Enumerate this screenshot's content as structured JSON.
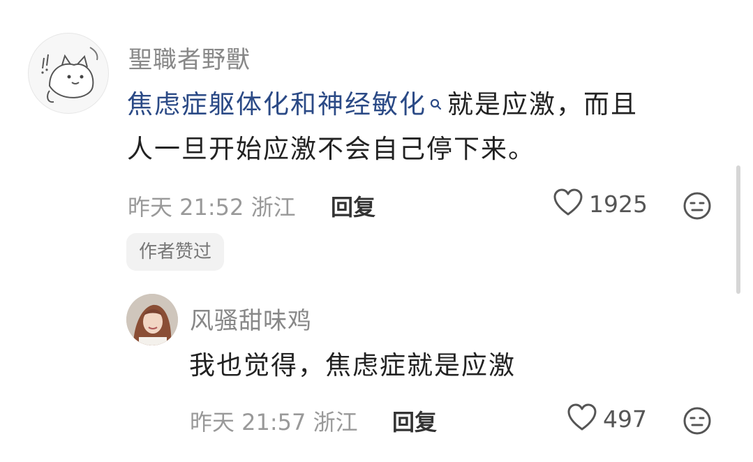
{
  "comment": {
    "username": "聖職者野獸",
    "link_text": "焦虑症躯体化和神经敏化",
    "text_line1": "就是应激，而且",
    "text_line2": "人一旦开始应激不会自己停下来。",
    "time": "昨天 21:52 浙江",
    "reply_label": "回复",
    "likes": "1925",
    "badge": "作者赞过"
  },
  "reply": {
    "username": "风骚甜味鸡",
    "text": "我也觉得，焦虑症就是应激",
    "time": "昨天 21:57 浙江",
    "reply_label": "回复",
    "likes": "497"
  },
  "icons": {
    "like": "heart-outline-icon",
    "dislike": "neutral-face-icon",
    "search": "search-icon"
  },
  "colors": {
    "link": "#2b4a86",
    "text": "#222222",
    "meta": "#999999",
    "badge_bg": "#f2f2f2"
  }
}
